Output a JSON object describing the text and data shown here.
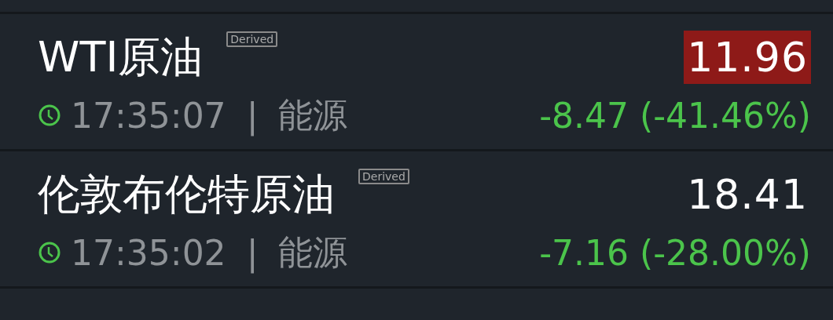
{
  "quotes": [
    {
      "name": "WTI原油",
      "badge": "Derived",
      "price": "11.96",
      "highlighted": true,
      "time": "17:35:07",
      "separator": "|",
      "category": "能源",
      "change": "-8.47 (-41.46%)"
    },
    {
      "name": "伦敦布伦特原油",
      "badge": "Derived",
      "price": "18.41",
      "highlighted": false,
      "time": "17:35:02",
      "separator": "|",
      "category": "能源",
      "change": "-7.16 (-28.00%)"
    }
  ]
}
